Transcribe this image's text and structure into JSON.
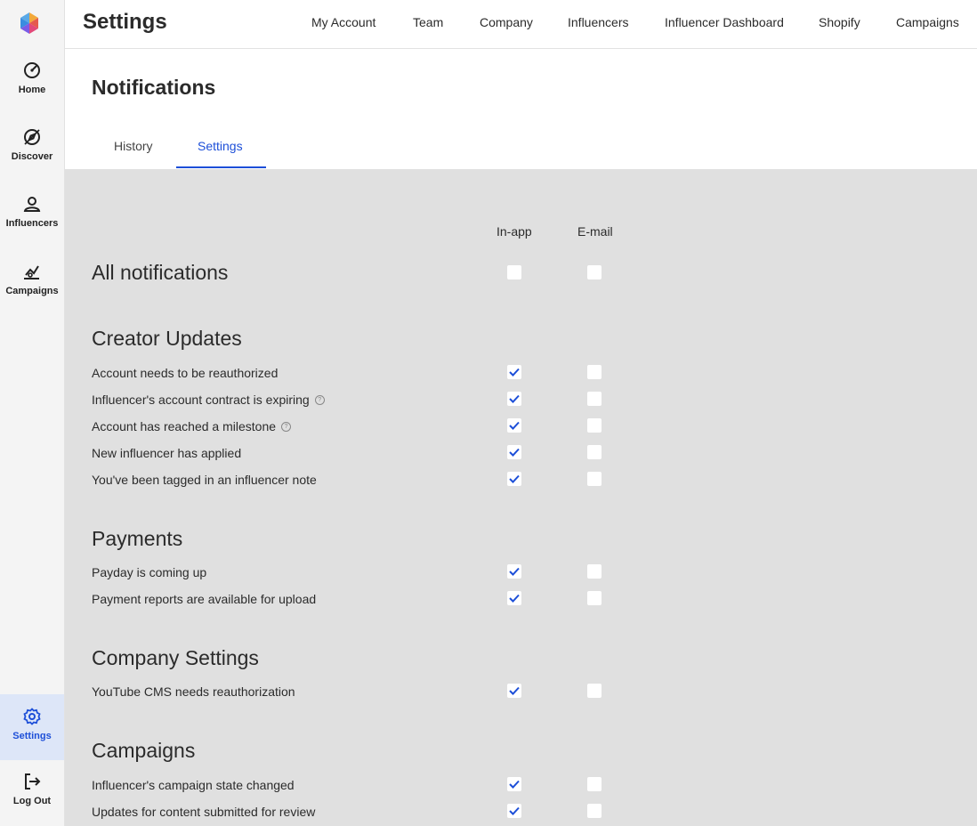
{
  "sidebar": {
    "items": [
      {
        "label": "Home",
        "icon": "gauge-icon"
      },
      {
        "label": "Discover",
        "icon": "compass-icon"
      },
      {
        "label": "Influencers",
        "icon": "person-icon"
      },
      {
        "label": "Campaigns",
        "icon": "chart-icon"
      },
      {
        "label": "Settings",
        "icon": "gear-icon"
      },
      {
        "label": "Log Out",
        "icon": "logout-icon"
      }
    ]
  },
  "header": {
    "title": "Settings",
    "nav": [
      "My Account",
      "Team",
      "Company",
      "Influencers",
      "Influencer Dashboard",
      "Shopify",
      "Campaigns"
    ]
  },
  "page": {
    "title": "Notifications",
    "tabs": [
      "History",
      "Settings"
    ]
  },
  "columns": {
    "in_app": "In-app",
    "email": "E-mail"
  },
  "all": {
    "label": "All notifications",
    "in_app": false,
    "email": false
  },
  "sections": [
    {
      "title": "Creator Updates",
      "rows": [
        {
          "label": "Account needs to be reauthorized",
          "help": false,
          "in_app": true,
          "email": false
        },
        {
          "label": "Influencer's account contract is expiring",
          "help": true,
          "in_app": true,
          "email": false
        },
        {
          "label": "Account has reached a milestone",
          "help": true,
          "in_app": true,
          "email": false
        },
        {
          "label": "New influencer has applied",
          "help": false,
          "in_app": true,
          "email": false
        },
        {
          "label": "You've been tagged in an influencer note",
          "help": false,
          "in_app": true,
          "email": false
        }
      ]
    },
    {
      "title": "Payments",
      "rows": [
        {
          "label": "Payday is coming up",
          "help": false,
          "in_app": true,
          "email": false
        },
        {
          "label": "Payment reports are available for upload",
          "help": false,
          "in_app": true,
          "email": false
        }
      ]
    },
    {
      "title": "Company Settings",
      "rows": [
        {
          "label": "YouTube CMS needs reauthorization",
          "help": false,
          "in_app": true,
          "email": false
        }
      ]
    },
    {
      "title": "Campaigns",
      "rows": [
        {
          "label": "Influencer's campaign state changed",
          "help": false,
          "in_app": true,
          "email": false
        },
        {
          "label": "Updates for content submitted for review",
          "help": false,
          "in_app": true,
          "email": false
        }
      ]
    }
  ],
  "colors": {
    "accent": "#1d4fd8",
    "panel_bg": "#e0e0e0"
  }
}
